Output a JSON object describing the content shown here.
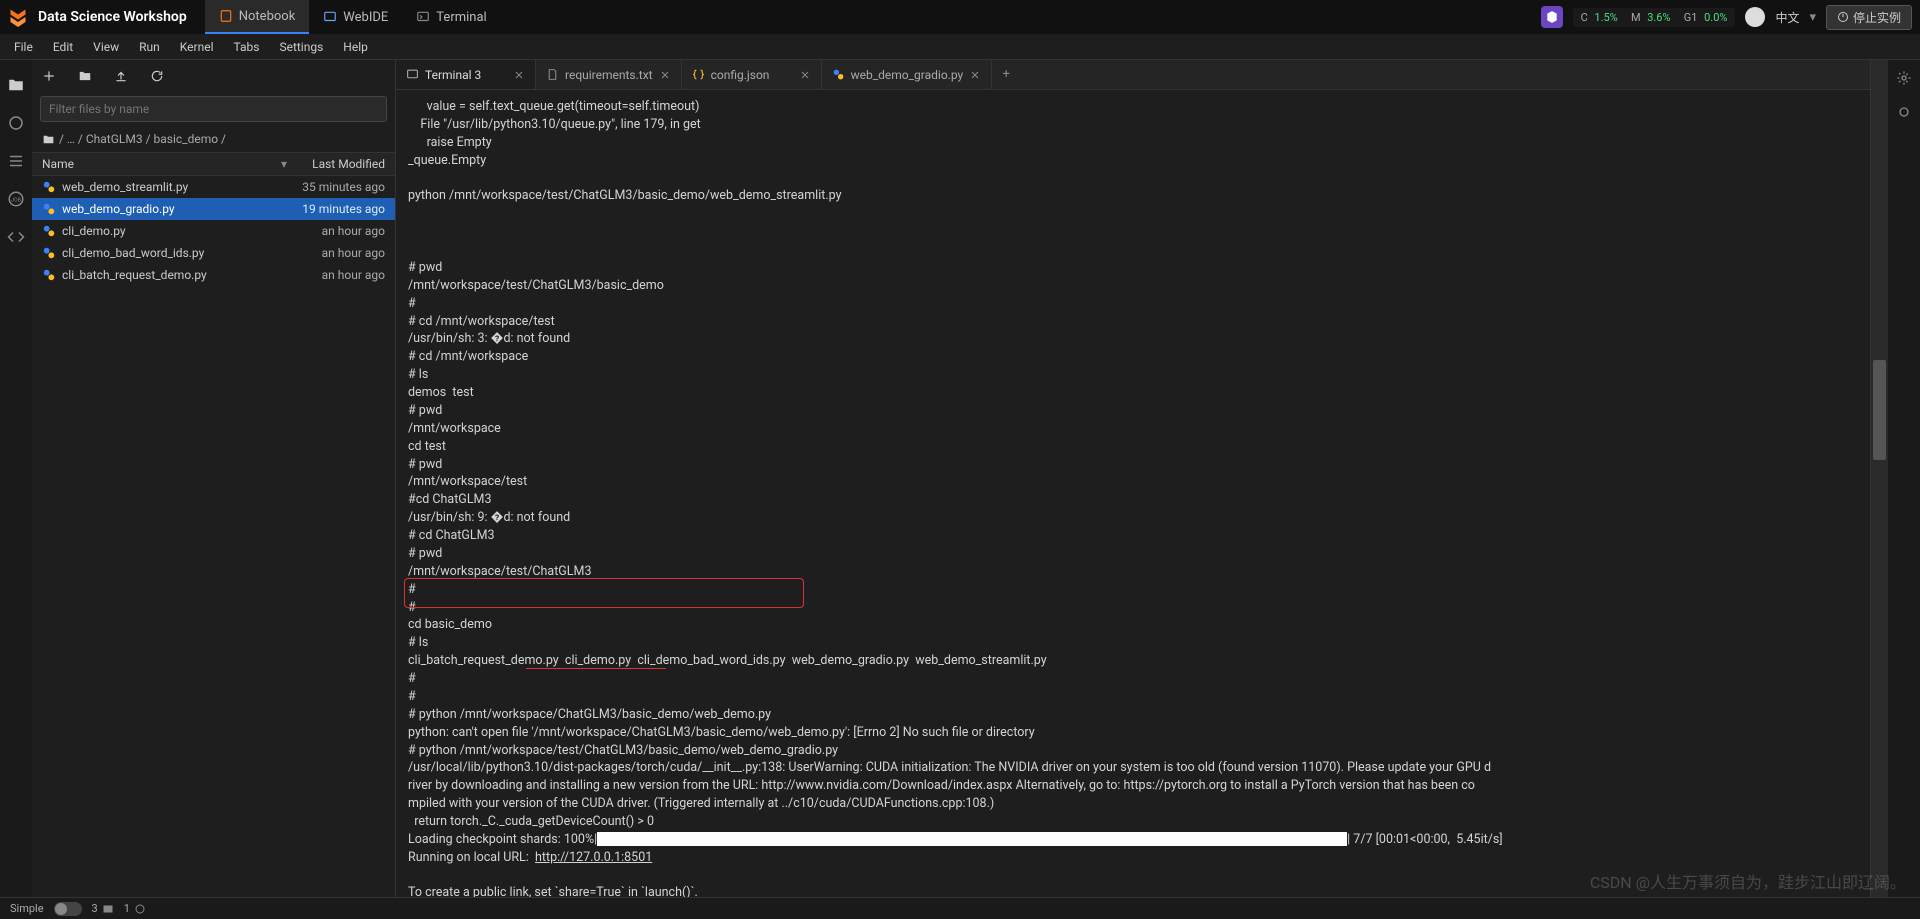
{
  "header": {
    "app_title": "Data Science Workshop",
    "tabs": [
      {
        "icon": "notebook-icon",
        "label": "Notebook",
        "active": true
      },
      {
        "icon": "webide-icon",
        "label": "WebIDE",
        "active": false
      },
      {
        "icon": "terminal-icon",
        "label": "Terminal",
        "active": false
      }
    ],
    "metrics_raw": "C 1.5%  M 3.6%  G1 0.0%",
    "metrics": {
      "c_label": "C",
      "c": "1.5%",
      "m_label": "M",
      "m": "3.6%",
      "g_label": "G1",
      "g": "0.0%"
    },
    "lang": "中文",
    "stop_label": "停止实例"
  },
  "menu": [
    "File",
    "Edit",
    "View",
    "Run",
    "Kernel",
    "Tabs",
    "Settings",
    "Help"
  ],
  "filebrowser": {
    "filter_placeholder": "Filter files by name",
    "breadcrumb": "/ … / ChatGLM3 / basic_demo /",
    "col_name": "Name",
    "col_mod": "Last Modified",
    "rows": [
      {
        "name": "web_demo_streamlit.py",
        "mod": "35 minutes ago",
        "sel": false
      },
      {
        "name": "web_demo_gradio.py",
        "mod": "19 minutes ago",
        "sel": true
      },
      {
        "name": "cli_demo.py",
        "mod": "an hour ago",
        "sel": false
      },
      {
        "name": "cli_demo_bad_word_ids.py",
        "mod": "an hour ago",
        "sel": false
      },
      {
        "name": "cli_batch_request_demo.py",
        "mod": "an hour ago",
        "sel": false
      }
    ]
  },
  "editor_tabs": [
    {
      "icon": "terminal-icon",
      "label": "Terminal 3",
      "active": true
    },
    {
      "icon": "file-icon",
      "label": "requirements.txt",
      "active": false
    },
    {
      "icon": "json-icon",
      "label": "config.json",
      "active": false
    },
    {
      "icon": "python-icon",
      "label": "web_demo_gradio.py",
      "active": false
    }
  ],
  "terminal": {
    "pre_lines": "      value = self.text_queue.get(timeout=self.timeout)\n    File \"/usr/lib/python3.10/queue.py\", line 179, in get\n      raise Empty\n_queue.Empty\n\npython /mnt/workspace/test/ChatGLM3/basic_demo/web_demo_streamlit.py\n\n\n\n# pwd\n/mnt/workspace/test/ChatGLM3/basic_demo\n#\n# cd /mnt/workspace/test\n/usr/bin/sh: 3: �d: not found\n# cd /mnt/workspace\n# ls\ndemos  test\n# pwd\n/mnt/workspace\ncd test\n# pwd\n/mnt/workspace/test\n#cd ChatGLM3\n/usr/bin/sh: 9: �d: not found\n# cd ChatGLM3\n# pwd\n/mnt/workspace/test/ChatGLM3\n#\n#\ncd basic_demo\n# ls\ncli_batch_request_demo.py  cli_demo.py  cli_demo_bad_word_ids.py  web_demo_gradio.py  web_demo_streamlit.py\n#\n#\n# python /mnt/workspace/ChatGLM3/basic_demo/web_demo.py\npython: can't open file '/mnt/workspace/ChatGLM3/basic_demo/web_demo.py': [Errno 2] No such file or directory",
    "hl_cmd": "# python /mnt/workspace/test/ChatGLM3/basic_demo/web_demo_gradio.py",
    "hl_path": "/usr/local/lib/python3.10/dist-packages/torch/cuda/__init__.py:138:",
    "warn_tail": " UserWarning: CUDA initialization: The NVIDIA driver on your system is too old (found version 11070). Please update your GPU d",
    "warn2": "river by downloading and installing a new version from the URL: http://www.nvidia.com/Download/index.aspx Alternatively, go to: https://pytorch.org to install a PyTorch version that has been co",
    "warn3": "mpiled with your version of the CUDA driver. (Triggered internally at ../c10/cuda/CUDAFunctions.cpp:108.)",
    "warn4": "  return torch._C._cuda_getDeviceCount() > 0",
    "load": "Loading checkpoint shards: 100%|",
    "load_tail": "| 7/7 [00:01<00:00,  5.45it/s]",
    "run_pre": "Running on local URL:  ",
    "run_url": "http://127.0.0.1:8501",
    "share": "To create a public link, set `share=True` in `launch()`."
  },
  "status": {
    "mode": "Simple",
    "num1": "3",
    "num2": "1"
  },
  "watermark": "CSDN @人生万事须自为，跬步江山即辽阔。"
}
